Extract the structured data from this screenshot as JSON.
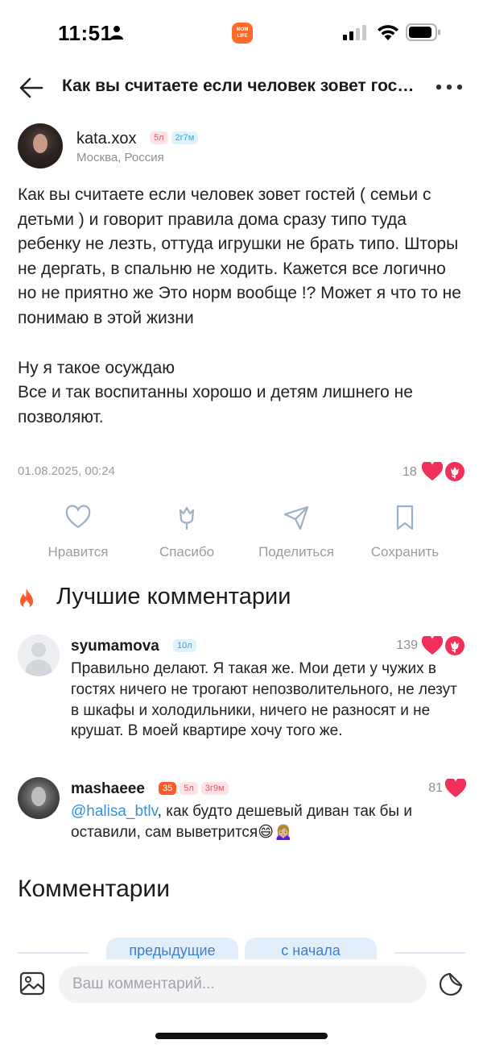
{
  "status_bar": {
    "time": "11:51",
    "app_badge_text": "MOM LIFE",
    "icons": [
      "person-icon",
      "signal-icon",
      "wifi-icon",
      "battery-icon"
    ]
  },
  "header": {
    "title": "Как вы считаете если человек зовет гостей ( семьи с детьми ) и говорит правила дома",
    "back_icon": "arrow-left-icon",
    "more_icon": "more-horizontal-icon"
  },
  "author": {
    "name": "kata.xox",
    "badges": [
      "5л",
      "2г7м"
    ],
    "location": "Москва, Россия"
  },
  "post": {
    "paragraph1": "Как вы считаете если человек зовет гостей ( семьи с детьми ) и говорит правила дома сразу типо туда ребенку не лезть, оттуда игрушки не брать типо. Шторы не дергать, в спальню не ходить. Кажется все логично но не приятно же Это норм вообще !? Может я что то не понимаю в этой жизни",
    "paragraph2": "Ну я такое осуждаю",
    "paragraph3": "Все и так воспитанны хорошо и детям лишнего не позволяют.",
    "date": "01.08.2025, 00:24",
    "reactions_count": "18"
  },
  "actions": [
    {
      "label": "Нравится",
      "icon": "heart-outline-icon"
    },
    {
      "label": "Спасибо",
      "icon": "tulip-outline-icon"
    },
    {
      "label": "Поделиться",
      "icon": "send-icon"
    },
    {
      "label": "Сохранить",
      "icon": "bookmark-icon"
    }
  ],
  "best_comments": {
    "title": "Лучшие комментарии",
    "icon": "fire-icon",
    "items": [
      {
        "author": "syumamova",
        "badges": [
          "10л"
        ],
        "count": "139",
        "text": "Правильно делают. Я такая же. Мои дети у чужих в гостях ничего не трогают непозволительного, не лезут в шкафы и холодильники, ничего не разносят и не крушат. В моей квартире хочу того же."
      },
      {
        "author": "mashaeee",
        "badges": [
          "35",
          "5л",
          "3г9м"
        ],
        "count": "81",
        "mention": "@halisa_btlv",
        "text": ", как будто дешевый диван так бы и оставили, сам выветрится😄🙍🏼‍♀️"
      }
    ]
  },
  "comments_section": {
    "title": "Комментарии",
    "prev_button": "предыдущие",
    "first_button": "с начала"
  },
  "composer": {
    "placeholder": "Ваш комментарий..."
  },
  "colors": {
    "heart": "#f0305a",
    "mention": "#3a8fd8",
    "accent_orange": "#ff5a2b"
  }
}
